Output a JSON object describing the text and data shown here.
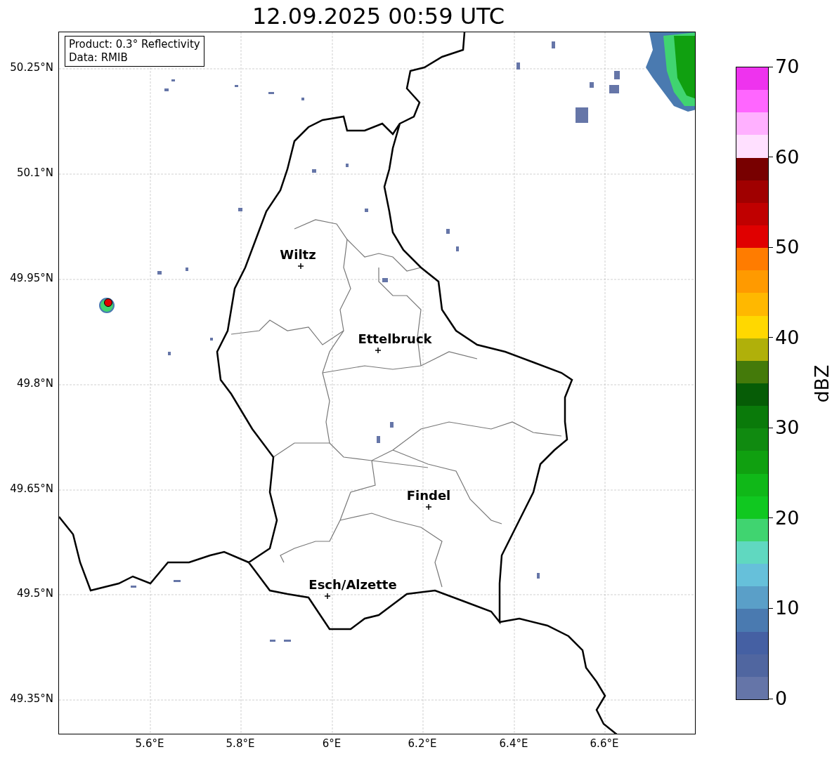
{
  "title": "12.09.2025 00:59 UTC",
  "info_box": {
    "lines": [
      "Product: 0.3° Reflectivity",
      "Data: RMIB"
    ]
  },
  "cities": [
    {
      "label": "Wiltz"
    },
    {
      "label": "Ettelbruck"
    },
    {
      "label": "Findel"
    },
    {
      "label": "Esch/Alzette"
    }
  ],
  "y_ticks": [
    "50.25°N",
    "50.1°N",
    "49.95°N",
    "49.8°N",
    "49.65°N",
    "49.5°N",
    "49.35°N"
  ],
  "x_ticks": [
    "5.6°E",
    "5.8°E",
    "6°E",
    "6.2°E",
    "6.4°E",
    "6.6°E"
  ],
  "colorbar": {
    "label": "dBZ",
    "ticks": [
      "70",
      "60",
      "50",
      "40",
      "30",
      "20",
      "10",
      "0"
    ],
    "segments": [
      {
        "color": "#6575a8"
      },
      {
        "color": "#5066a0"
      },
      {
        "color": "#4560a3"
      },
      {
        "color": "#4a7ab0"
      },
      {
        "color": "#5a9fc8"
      },
      {
        "color": "#66c0da"
      },
      {
        "color": "#60d8c0"
      },
      {
        "color": "#40d470"
      },
      {
        "color": "#10c820"
      },
      {
        "color": "#10b818"
      },
      {
        "color": "#10a010"
      },
      {
        "color": "#108a10"
      },
      {
        "color": "#0a7a0a"
      },
      {
        "color": "#065c06"
      },
      {
        "color": "#447a0a"
      },
      {
        "color": "#b0b00a"
      },
      {
        "color": "#ffd800"
      },
      {
        "color": "#ffb800"
      },
      {
        "color": "#ff9a00"
      },
      {
        "color": "#ff7c00"
      },
      {
        "color": "#e00000"
      },
      {
        "color": "#c00000"
      },
      {
        "color": "#a00000"
      },
      {
        "color": "#780000"
      },
      {
        "color": "#ffe0ff"
      },
      {
        "color": "#ffb0ff"
      },
      {
        "color": "#ff66ff"
      },
      {
        "color": "#ee33ee"
      }
    ]
  }
}
